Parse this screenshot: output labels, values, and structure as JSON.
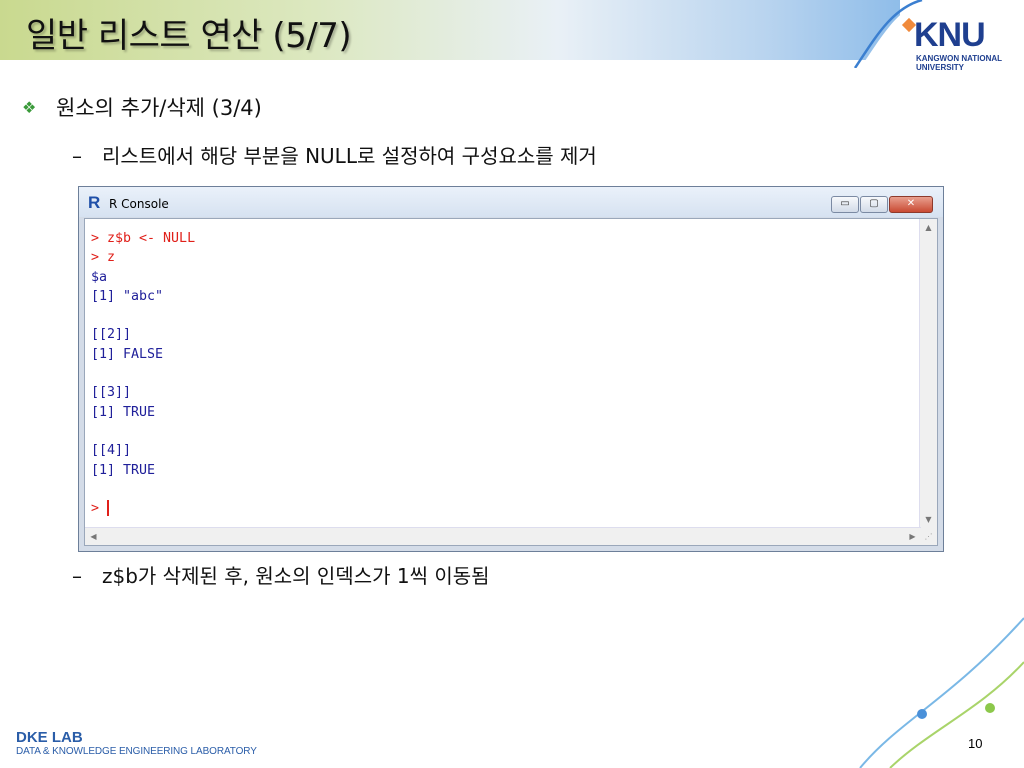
{
  "slide": {
    "title": "일반 리스트 연산 (5/7)",
    "bullet_main": "원소의 추가/삭제 (3/4)",
    "sub_bullet_1": "리스트에서 해당 부분을 NULL로 설정하여 구성요소를 제거",
    "sub_bullet_2": "z$b가 삭제된 후, 원소의 인덱스가 1씩 이동됨",
    "dash": "–",
    "page_number": "10"
  },
  "logo": {
    "name": "KNU",
    "subtitle_line1": "KANGWON NATIONAL",
    "subtitle_line2": "UNIVERSITY"
  },
  "footer": {
    "lab_name": "DKE LAB",
    "lab_full": "DATA & KNOWLEDGE ENGINEERING LABORATORY"
  },
  "window": {
    "title": "R Console",
    "app_letter": "R",
    "minimize_symbol": "▭",
    "maximize_symbol": "▢",
    "close_symbol": "✕"
  },
  "console": {
    "lines": [
      {
        "text": "> z$b <- NULL",
        "type": "in"
      },
      {
        "text": "> z",
        "type": "in"
      },
      {
        "text": "$a",
        "type": "out"
      },
      {
        "text": "[1] \"abc\"",
        "type": "out"
      },
      {
        "text": "",
        "type": "out"
      },
      {
        "text": "[[2]]",
        "type": "out"
      },
      {
        "text": "[1] FALSE",
        "type": "out"
      },
      {
        "text": "",
        "type": "out"
      },
      {
        "text": "[[3]]",
        "type": "out"
      },
      {
        "text": "[1] TRUE",
        "type": "out"
      },
      {
        "text": "",
        "type": "out"
      },
      {
        "text": "[[4]]",
        "type": "out"
      },
      {
        "text": "[1] TRUE",
        "type": "out"
      },
      {
        "text": "",
        "type": "out"
      },
      {
        "text": ">",
        "type": "in"
      }
    ]
  },
  "colors": {
    "console_input": "#e0201a",
    "console_output": "#20209a",
    "bullet_accent": "#3a9a3a",
    "footer_blue": "#2a5da8"
  },
  "icons": {
    "bullet": "diamond-cluster-icon",
    "app": "r-logo-icon",
    "scroll_up": "arrow-up-icon",
    "scroll_down": "arrow-down-icon",
    "scroll_left": "arrow-left-icon",
    "scroll_right": "arrow-right-icon"
  }
}
